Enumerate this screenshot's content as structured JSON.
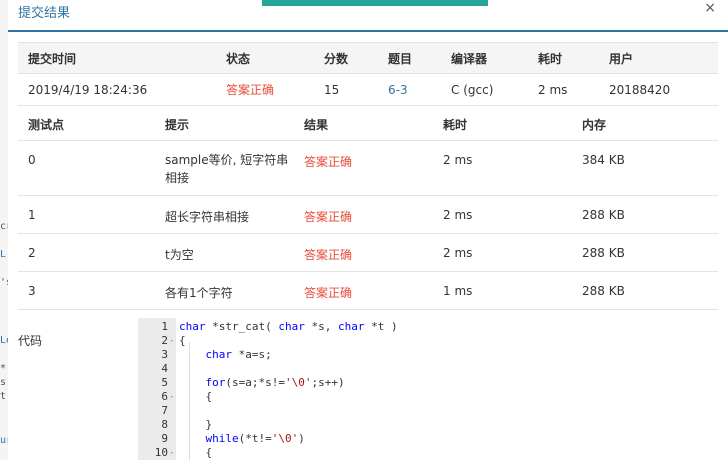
{
  "background_fragments": [
    "cr",
    "L",
    "'s",
    "Le",
    "*",
    "s",
    "t",
    "ur"
  ],
  "modal": {
    "title": "提交结果",
    "close_glyph": "×"
  },
  "submission": {
    "headers": [
      "提交时间",
      "状态",
      "分数",
      "题目",
      "编译器",
      "耗时",
      "用户"
    ],
    "row": [
      "2019/4/19 18:24:36",
      "答案正确",
      "15",
      "6-3",
      "C (gcc)",
      "2 ms",
      "20188420"
    ]
  },
  "testcases": {
    "headers": [
      "测试点",
      "提示",
      "结果",
      "耗时",
      "内存"
    ],
    "rows": [
      {
        "id": "0",
        "hint": "sample等价, 短字符串相接",
        "result": "答案正确",
        "time": "2 ms",
        "memory": "384 KB"
      },
      {
        "id": "1",
        "hint": "超长字符串相接",
        "result": "答案正确",
        "time": "2 ms",
        "memory": "288 KB"
      },
      {
        "id": "2",
        "hint": "t为空",
        "result": "答案正确",
        "time": "2 ms",
        "memory": "288 KB"
      },
      {
        "id": "3",
        "hint": "各有1个字符",
        "result": "答案正确",
        "time": "1 ms",
        "memory": "288 KB"
      }
    ]
  },
  "code": {
    "label": "代码",
    "lines": [
      {
        "n": "1",
        "text": "char *str_cat( char *s, char *t )"
      },
      {
        "n": "2",
        "text": "{",
        "fold": "-"
      },
      {
        "n": "3",
        "text": "    char *a=s;"
      },
      {
        "n": "4",
        "text": ""
      },
      {
        "n": "5",
        "text": "    for(s=a;*s!='\\0';s++)"
      },
      {
        "n": "6",
        "text": "    {",
        "fold": "-"
      },
      {
        "n": "7",
        "text": ""
      },
      {
        "n": "8",
        "text": "    }"
      },
      {
        "n": "9",
        "text": "    while(*t!='\\0')"
      },
      {
        "n": "10",
        "text": "    {",
        "fold": "-"
      }
    ]
  },
  "colors": {
    "accent": "#2f74a3",
    "status_ok": "#e74c3c",
    "progress": "#26a69a"
  }
}
